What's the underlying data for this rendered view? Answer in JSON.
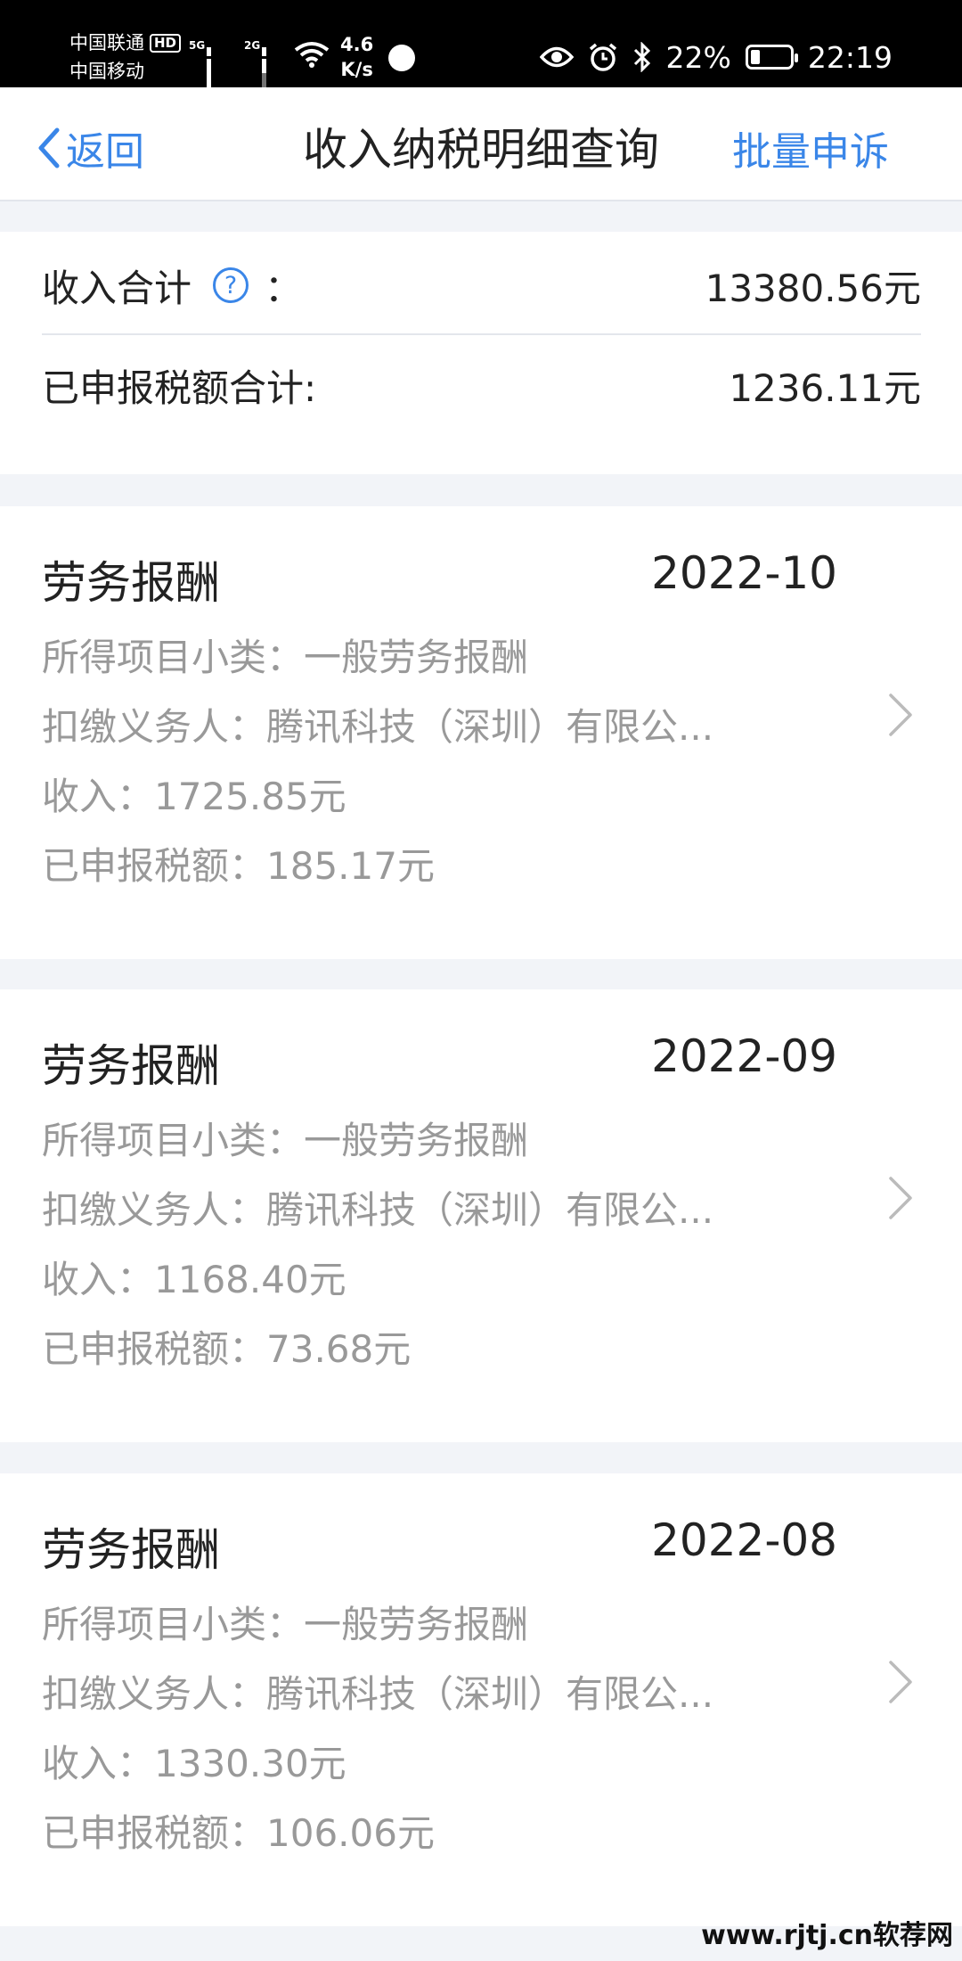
{
  "status_bar": {
    "carrier1": "中国联通",
    "carrier1_badge": "HD",
    "carrier2": "中国移动",
    "net1": "5G",
    "net2": "2G",
    "speed_value": "4.6",
    "speed_unit": "K/s",
    "battery": "22%",
    "time": "22:19"
  },
  "nav": {
    "back_label": "返回",
    "title": "收入纳税明细查询",
    "appeal_label": "批量申诉"
  },
  "summary": {
    "income_label": "收入合计",
    "help_icon_glyph": "?",
    "income_colon": "：",
    "income_value": "13380.56元",
    "tax_label": "已申报税额合计:",
    "tax_value": "1236.11元"
  },
  "records": [
    {
      "type": "劳务报酬",
      "month": "2022-10",
      "subcategory": "所得项目小类：一般劳务报酬",
      "withholder": "扣缴义务人：腾讯科技（深圳）有限公...",
      "income": "收入：1725.85元",
      "tax": "已申报税额：185.17元"
    },
    {
      "type": "劳务报酬",
      "month": "2022-09",
      "subcategory": "所得项目小类：一般劳务报酬",
      "withholder": "扣缴义务人：腾讯科技（深圳）有限公...",
      "income": "收入：1168.40元",
      "tax": "已申报税额：73.68元"
    },
    {
      "type": "劳务报酬",
      "month": "2022-08",
      "subcategory": "所得项目小类：一般劳务报酬",
      "withholder": "扣缴义务人：腾讯科技（深圳）有限公...",
      "income": "收入：1330.30元",
      "tax": "已申报税额：106.06元"
    }
  ],
  "watermark": "www.rjtj.cn软荐网",
  "colors": {
    "accent": "#3a86e8",
    "background": "#f2f4f8",
    "secondary_text": "#999999"
  }
}
